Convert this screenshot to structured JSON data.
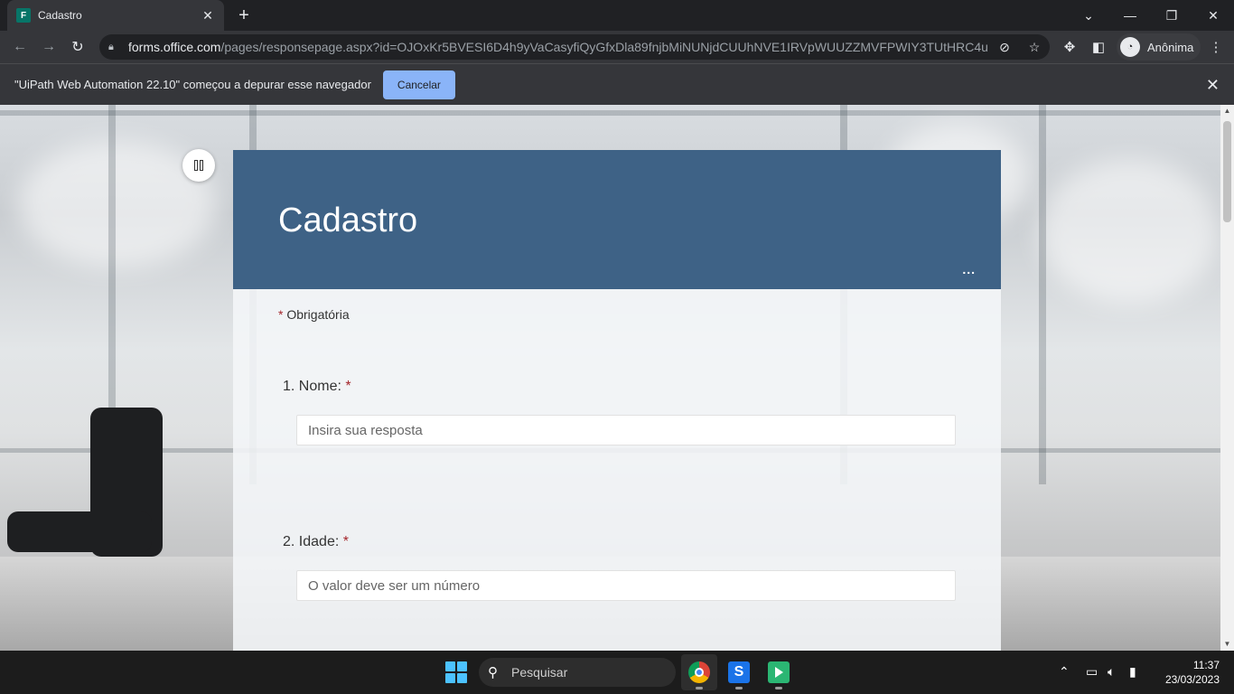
{
  "browser": {
    "tab_title": "Cadastro",
    "tab_favicon_letter": "F",
    "url_host": "forms.office.com",
    "url_path": "/pages/responsepage.aspx?id=OJOxKr5BVESI6D4h9yVaCasyfiQyGfxDla89fnjbMiNUNjdCUUhNVE1IRVpWUUZZMVFPWIY3TUtHRC4u",
    "profile_label": "Anônima"
  },
  "infobar": {
    "message": "\"UiPath Web Automation 22.10\" começou a depurar esse navegador",
    "cancel_label": "Cancelar"
  },
  "form": {
    "title": "Cadastro",
    "more_label": "...",
    "required_note": "Obrigatória",
    "required_marker": "*",
    "questions": [
      {
        "number": "1.",
        "label": "Nome:",
        "placeholder": "Insira sua resposta"
      },
      {
        "number": "2.",
        "label": "Idade:",
        "placeholder": "O valor deve ser um número"
      }
    ]
  },
  "taskbar": {
    "search_placeholder": "Pesquisar",
    "time": "11:37",
    "date": "23/03/2023"
  },
  "colors": {
    "form_header": "#3e6286",
    "required_star": "#a4262c",
    "infobar_button": "#8ab4f8"
  }
}
